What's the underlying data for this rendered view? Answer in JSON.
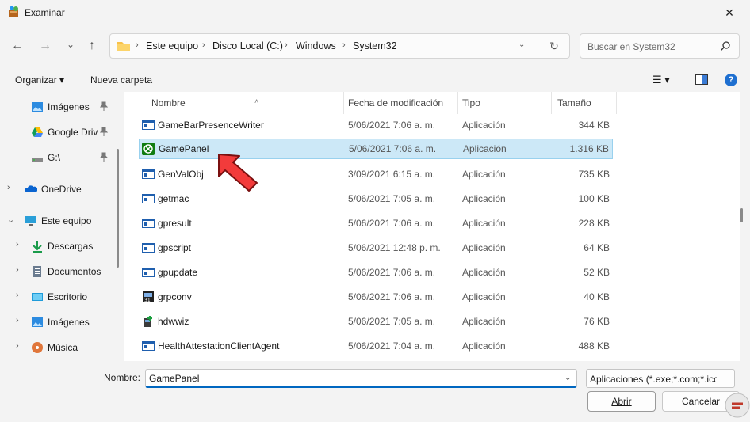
{
  "window": {
    "title": "Examinar",
    "close_glyph": "✕"
  },
  "nav": {
    "back_glyph": "←",
    "forward_glyph": "→",
    "recent_glyph": "⌄",
    "up_glyph": "↑",
    "breadcrumb": [
      "Este equipo",
      "Disco Local (C:)",
      "Windows",
      "System32"
    ],
    "sep_glyph": "›",
    "dropdown_glyph": "⌄",
    "refresh_glyph": "↻"
  },
  "search": {
    "placeholder": "Buscar en System32"
  },
  "commands": {
    "organize": "Organizar ▾",
    "new_folder": "Nueva carpeta",
    "view_glyph": "☰ ▾",
    "help_glyph": "?"
  },
  "sidebar": {
    "items": [
      {
        "label": "Imágenes",
        "chev": "",
        "pinned": true,
        "icon": "pictures-icon"
      },
      {
        "label": "Google Drive",
        "chev": "",
        "pinned": true,
        "icon": "google-drive-icon"
      },
      {
        "label": "G:\\",
        "chev": "",
        "pinned": true,
        "icon": "drive-icon"
      },
      {
        "label": "OneDrive",
        "chev": "›",
        "pinned": false,
        "icon": "onedrive-icon"
      },
      {
        "label": "Este equipo",
        "chev": "⌄",
        "pinned": false,
        "icon": "pc-icon"
      },
      {
        "label": "Descargas",
        "chev": "›",
        "pinned": false,
        "icon": "downloads-icon"
      },
      {
        "label": "Documentos",
        "chev": "›",
        "pinned": false,
        "icon": "documents-icon"
      },
      {
        "label": "Escritorio",
        "chev": "›",
        "pinned": false,
        "icon": "desktop-icon"
      },
      {
        "label": "Imágenes",
        "chev": "›",
        "pinned": false,
        "icon": "pictures-icon"
      },
      {
        "label": "Música",
        "chev": "›",
        "pinned": false,
        "icon": "music-icon"
      }
    ]
  },
  "columns": {
    "name": "Nombre",
    "date": "Fecha de modificación",
    "type": "Tipo",
    "size": "Tamaño",
    "sort_glyph": "˄"
  },
  "files": [
    {
      "name": "GameBarPresenceWriter",
      "date": "5/06/2021 7:06 a. m.",
      "type": "Aplicación",
      "size": "344 KB",
      "icon": "app-window-icon",
      "selected": false
    },
    {
      "name": "GamePanel",
      "date": "5/06/2021 7:06 a. m.",
      "type": "Aplicación",
      "size": "1.316 KB",
      "icon": "xbox-icon",
      "selected": true
    },
    {
      "name": "GenValObj",
      "date": "3/09/2021 6:15 a. m.",
      "type": "Aplicación",
      "size": "735 KB",
      "icon": "app-window-icon",
      "selected": false
    },
    {
      "name": "getmac",
      "date": "5/06/2021 7:05 a. m.",
      "type": "Aplicación",
      "size": "100 KB",
      "icon": "app-window-icon",
      "selected": false
    },
    {
      "name": "gpresult",
      "date": "5/06/2021 7:06 a. m.",
      "type": "Aplicación",
      "size": "228 KB",
      "icon": "app-window-icon",
      "selected": false
    },
    {
      "name": "gpscript",
      "date": "5/06/2021 12:48 p. m.",
      "type": "Aplicación",
      "size": "64 KB",
      "icon": "app-window-icon",
      "selected": false
    },
    {
      "name": "gpupdate",
      "date": "5/06/2021 7:06 a. m.",
      "type": "Aplicación",
      "size": "52 KB",
      "icon": "app-window-icon",
      "selected": false
    },
    {
      "name": "grpconv",
      "date": "5/06/2021 7:06 a. m.",
      "type": "Aplicación",
      "size": "40 KB",
      "icon": "grpconv-icon",
      "selected": false
    },
    {
      "name": "hdwwiz",
      "date": "5/06/2021 7:05 a. m.",
      "type": "Aplicación",
      "size": "76 KB",
      "icon": "hardware-wizard-icon",
      "selected": false
    },
    {
      "name": "HealthAttestationClientAgent",
      "date": "5/06/2021 7:04 a. m.",
      "type": "Aplicación",
      "size": "488 KB",
      "icon": "app-window-icon",
      "selected": false
    }
  ],
  "footer": {
    "name_label": "Nombre:",
    "name_value": "GamePanel",
    "filter": "Aplicaciones (*.exe;*.com;*.icd;",
    "open": "Abrir",
    "cancel": "Cancelar"
  },
  "colors": {
    "accent": "#0067c0",
    "selection": "#cce8f7",
    "arrow": "#f23b3b"
  }
}
